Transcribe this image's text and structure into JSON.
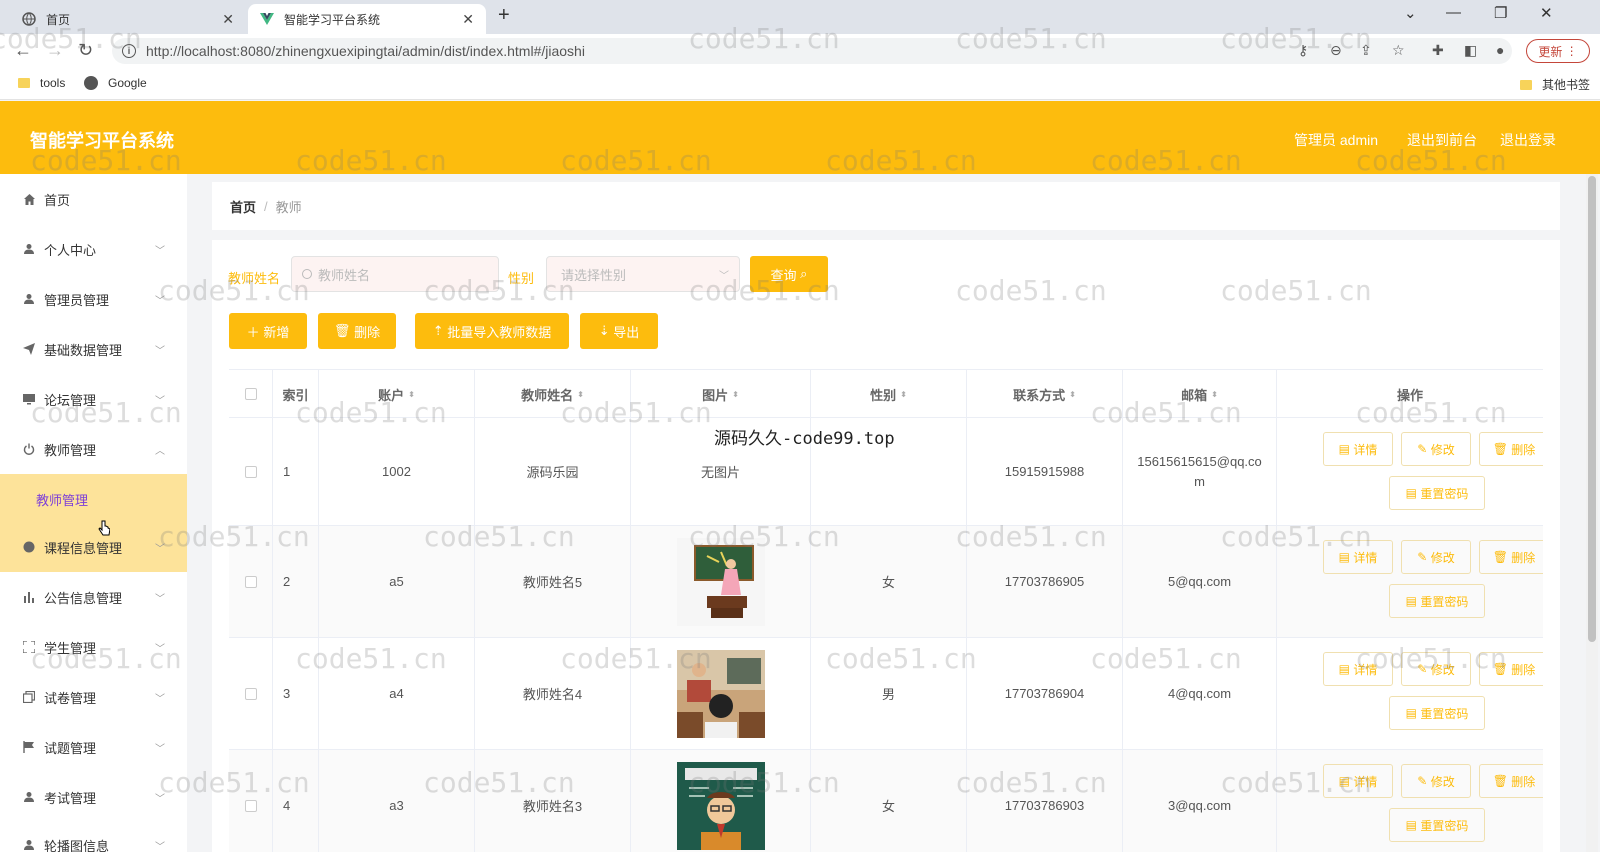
{
  "browser": {
    "tabs": [
      {
        "label": "首页"
      },
      {
        "label": "智能学习平台系统"
      }
    ],
    "url": "http://localhost:8080/zhinengxuexipingtai/admin/dist/index.html#/jiaoshi",
    "update_label": "更新",
    "bookmarks": [
      {
        "label": "tools"
      },
      {
        "label": "Google"
      }
    ],
    "other_bookmarks": "其他书签"
  },
  "header": {
    "title": "智能学习平台系统",
    "links": [
      "管理员 admin",
      "退出到前台",
      "退出登录"
    ]
  },
  "sidebar": {
    "items": [
      {
        "label": "首页",
        "icon": "home-icon"
      },
      {
        "label": "个人中心",
        "icon": "user-icon"
      },
      {
        "label": "管理员管理",
        "icon": "user-icon"
      },
      {
        "label": "基础数据管理",
        "icon": "paper-plane-icon"
      },
      {
        "label": "论坛管理",
        "icon": "monitor-icon"
      },
      {
        "label": "教师管理",
        "icon": "power-icon"
      },
      {
        "label": "教师管理"
      },
      {
        "label": "课程信息管理",
        "icon": "globe-icon"
      },
      {
        "label": "公告信息管理",
        "icon": "bar-chart-icon"
      },
      {
        "label": "学生管理",
        "icon": "fullscreen-icon"
      },
      {
        "label": "试卷管理",
        "icon": "copy-icon"
      },
      {
        "label": "试题管理",
        "icon": "flag-icon"
      },
      {
        "label": "考试管理",
        "icon": "user-icon"
      },
      {
        "label": "轮播图信息",
        "icon": "user-icon"
      }
    ]
  },
  "breadcrumb": {
    "home": "首页",
    "separator": "/",
    "current": "教师"
  },
  "search": {
    "name_label": "教师姓名",
    "name_placeholder": "教师姓名",
    "gender_label": "性别",
    "gender_placeholder": "请选择性别",
    "query_label": "查询"
  },
  "actions": {
    "add": "新增",
    "delete": "删除",
    "import": "批量导入教师数据",
    "export": "导出"
  },
  "table": {
    "columns": [
      "索引",
      "账户",
      "教师姓名",
      "图片",
      "性别",
      "联系方式",
      "邮箱",
      "操作"
    ],
    "row_actions": {
      "detail": "详情",
      "edit": "修改",
      "delete": "删除",
      "reset": "重置密码"
    },
    "rows": [
      {
        "index": "1",
        "account": "1002",
        "name": "源码乐园",
        "image": "无图片",
        "gender": "",
        "phone": "15915915988",
        "email": "15615615615@qq.com"
      },
      {
        "index": "2",
        "account": "a5",
        "name": "教师姓名5",
        "image": "",
        "gender": "女",
        "phone": "17703786905",
        "email": "5@qq.com"
      },
      {
        "index": "3",
        "account": "a4",
        "name": "教师姓名4",
        "image": "",
        "gender": "男",
        "phone": "17703786904",
        "email": "4@qq.com"
      },
      {
        "index": "4",
        "account": "a3",
        "name": "教师姓名3",
        "image": "",
        "gender": "女",
        "phone": "17703786903",
        "email": "3@qq.com"
      }
    ]
  },
  "overlay": "源码久久-code99.top",
  "watermark": "code51.cn"
}
